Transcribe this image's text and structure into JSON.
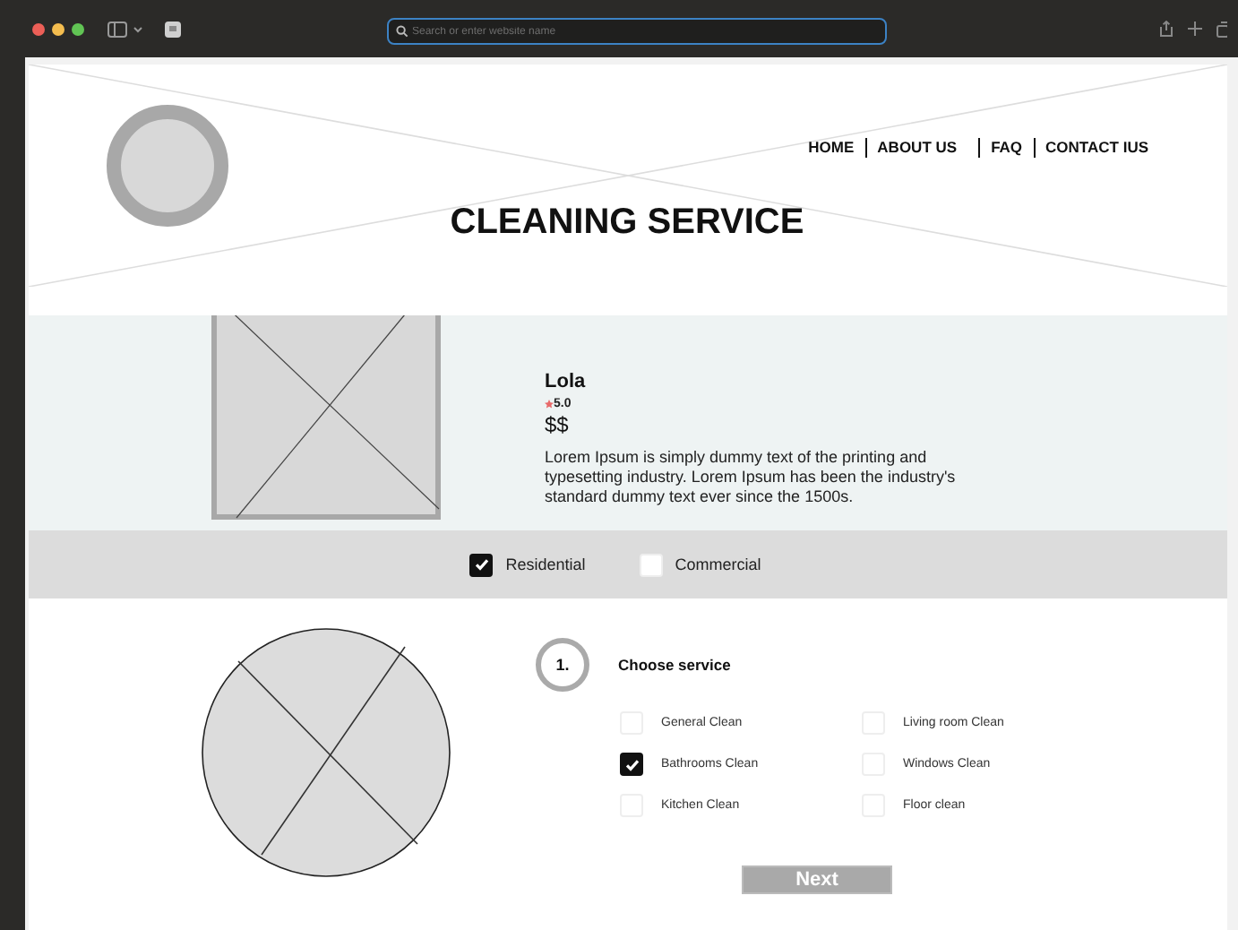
{
  "browser": {
    "address_placeholder": "Search or enter website name"
  },
  "nav": [
    {
      "label": "HOME"
    },
    {
      "label": "ABOUT US"
    },
    {
      "label": "FAQ"
    },
    {
      "label": "CONTACT IUS"
    }
  ],
  "title": "CLEANING SERVICE",
  "profile": {
    "name": "Lola",
    "rating": "5.0",
    "price": "$$",
    "description": "Lorem Ipsum is simply dummy text of the printing and typesetting industry. Lorem Ipsum has been the industry's standard dummy text ever since the 1500s."
  },
  "filters": [
    {
      "label": "Residential",
      "checked": true
    },
    {
      "label": "Commercial",
      "checked": false
    }
  ],
  "step": {
    "number": "1.",
    "title": "Choose service"
  },
  "services": [
    {
      "label": "General Clean",
      "checked": false
    },
    {
      "label": "Bathrooms Clean",
      "checked": true
    },
    {
      "label": "Kitchen Clean",
      "checked": false
    },
    {
      "label": "Living room Clean",
      "checked": false
    },
    {
      "label": "Windows Clean",
      "checked": false
    },
    {
      "label": "Floor clean",
      "checked": false
    }
  ],
  "next_button": "Next"
}
